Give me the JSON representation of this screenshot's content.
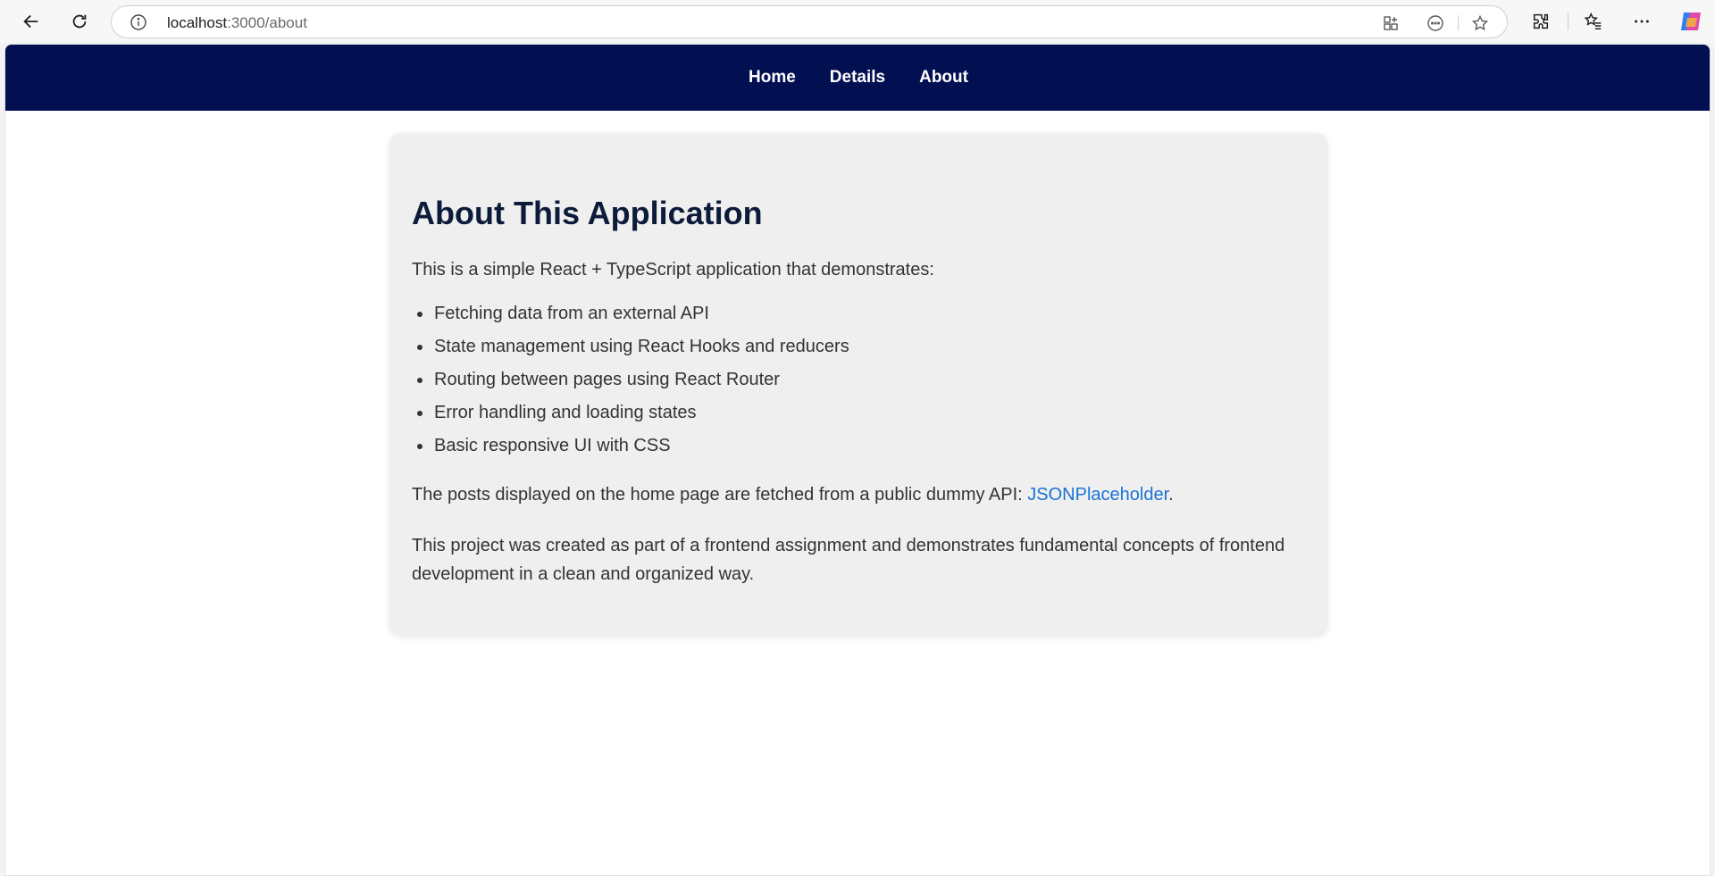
{
  "browser": {
    "url_host": "localhost",
    "url_path": ":3000/about"
  },
  "nav": {
    "links": [
      "Home",
      "Details",
      "About"
    ]
  },
  "about": {
    "title": "About This Application",
    "intro": "This is a simple React + TypeScript application that demonstrates:",
    "features": [
      "Fetching data from an external API",
      "State management using React Hooks and reducers",
      "Routing between pages using React Router",
      "Error handling and loading states",
      "Basic responsive UI with CSS"
    ],
    "api_text": "The posts displayed on the home page are fetched from a public dummy API: ",
    "api_link": "JSONPlaceholder",
    "api_suffix": ".",
    "closing": "This project was created as part of a frontend assignment and demonstrates fundamental concepts of frontend development in a clean and organized way."
  },
  "colors": {
    "navbar": "#021052",
    "card_bg": "#efefef",
    "heading": "#0d1b3a",
    "link": "#1a73d6"
  }
}
